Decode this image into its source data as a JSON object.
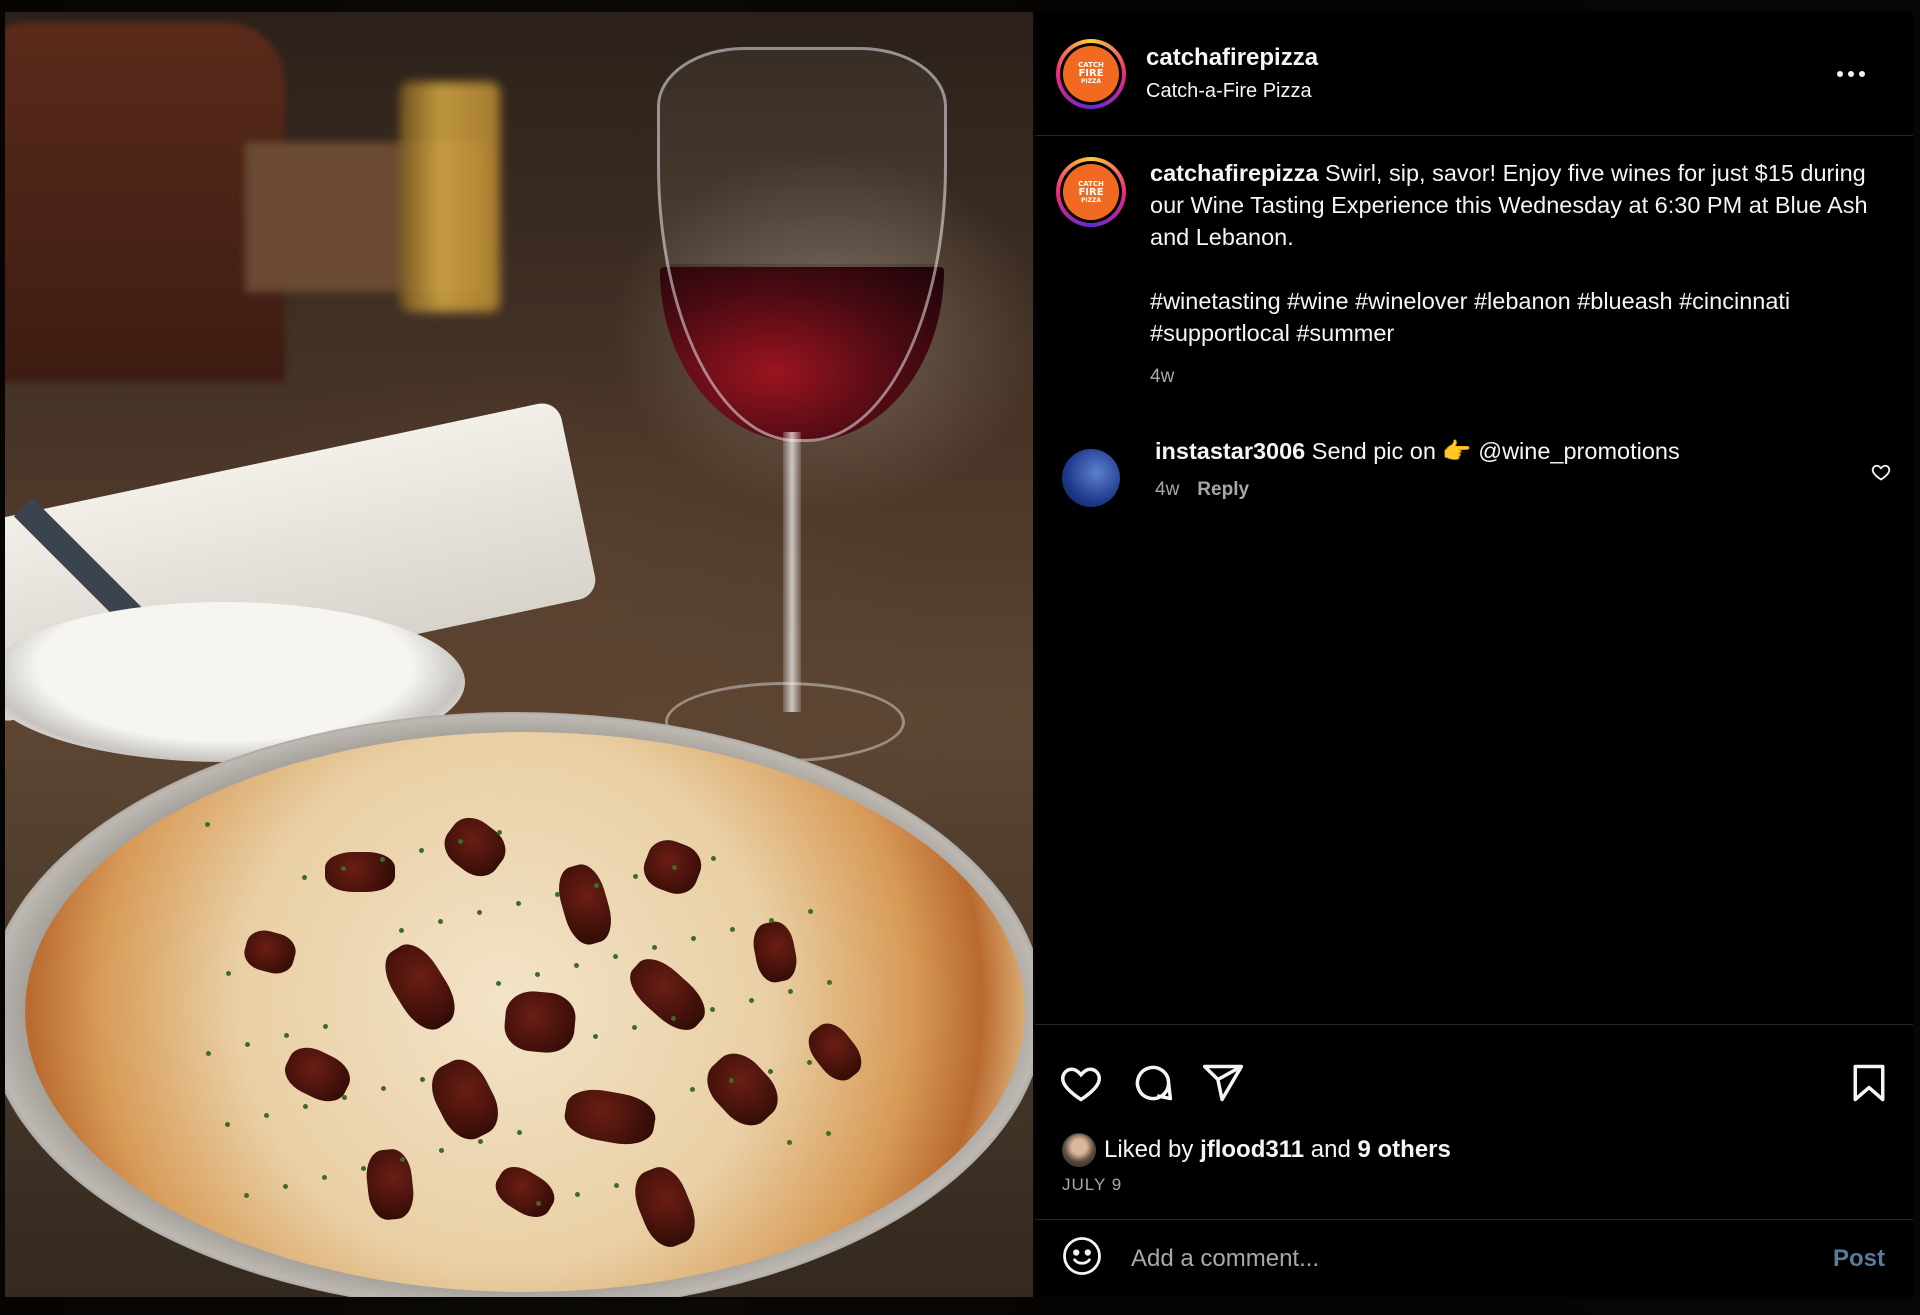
{
  "post": {
    "author": {
      "username": "catchafirepizza",
      "full_name": "Catch-a-Fire Pizza",
      "logo_text": [
        "CATCH",
        "FIRE",
        "PIZZA"
      ]
    },
    "caption": {
      "username": "catchafirepizza",
      "text": "Swirl, sip, savor! Enjoy five wines for just $15 during our Wine Tasting Experience this Wednesday at 6:30 PM at Blue Ash and Lebanon.",
      "hashtags": "#winetasting #wine #winelover #lebanon #blueash #cincinnati #supportlocal #summer",
      "time": "4w"
    },
    "comments": [
      {
        "username": "instastar3006",
        "text": "Send pic on 👉 @wine_promotions",
        "time": "4w",
        "reply_label": "Reply"
      }
    ],
    "likes": {
      "prefix": "Liked by",
      "first_liker": "jflood311",
      "joiner": "and",
      "others": "9 others"
    },
    "date": "JULY 9",
    "add_comment": {
      "placeholder": "Add a comment...",
      "post_label": "Post"
    }
  },
  "icons": [
    "more-icon",
    "heart-icon",
    "comment-icon",
    "share-icon",
    "bookmark-icon",
    "emoji-icon"
  ],
  "colors": {
    "background": "#000000",
    "text": "#f5f5f5",
    "muted": "#a8a8a8",
    "post_button": "#5a7a9a",
    "logo": "#f26a21"
  }
}
